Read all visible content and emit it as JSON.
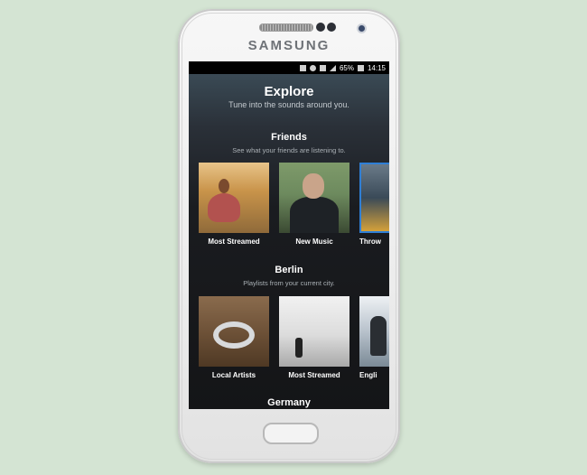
{
  "device": {
    "brand": "SAMSUNG"
  },
  "status_bar": {
    "battery": "65%",
    "time": "14:15"
  },
  "header": {
    "title": "Explore",
    "subtitle": "Tune into the sounds around you."
  },
  "sections": [
    {
      "title": "Friends",
      "subtitle": "See what your friends are listening to.",
      "cards": [
        {
          "label": "Most Streamed",
          "image": "woman-in-field"
        },
        {
          "label": "New Music",
          "image": "man-portrait"
        },
        {
          "label": "Throw",
          "image": "music-equipment"
        }
      ]
    },
    {
      "title": "Berlin",
      "subtitle": "Playlists from your current city.",
      "cards": [
        {
          "label": "Local Artists",
          "image": "headphones-on-wood"
        },
        {
          "label": "Most Streamed",
          "image": "person-on-beach"
        },
        {
          "label": "Engli",
          "image": "man-in-room"
        }
      ]
    },
    {
      "title": "Germany"
    }
  ],
  "colors": {
    "background": "#d4e4d3",
    "screen": "#15181c",
    "accent": "#2f7fd6"
  }
}
